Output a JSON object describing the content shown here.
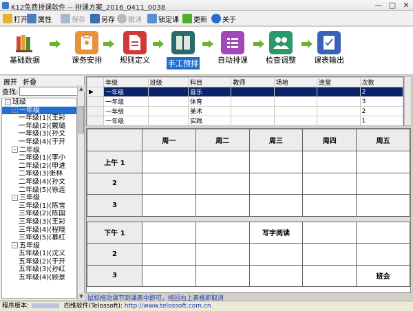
{
  "window": {
    "title": "K12免费排课软件 -- 排课方案_2016_0411_0038",
    "buttons": [
      "—",
      "□",
      "✕"
    ]
  },
  "toolbar": {
    "open": "打开",
    "properties": "属性",
    "save": "保存",
    "save_as": "另存",
    "undo": "撤消",
    "lock": "锁定课",
    "update": "更新",
    "about": "关于"
  },
  "flow": {
    "steps": [
      "基础数据",
      "课务安排",
      "规则定义",
      "手工预排",
      "自动排课",
      "检查调整",
      "课表输出"
    ],
    "active_index": 3
  },
  "left": {
    "expand": "展开",
    "collapse": "折叠",
    "search_label": "查找:",
    "tree": [
      {
        "text": "班级",
        "level": 0,
        "expander": "-"
      },
      {
        "text": "一年级",
        "level": 1,
        "expander": "-",
        "selected": true
      },
      {
        "text": "一年级(1)(王彩",
        "level": 2
      },
      {
        "text": "一年级(2)(戴璐",
        "level": 2
      },
      {
        "text": "一年级(3)(孙文",
        "level": 2
      },
      {
        "text": "一年级(4)(于开",
        "level": 2
      },
      {
        "text": "二年级",
        "level": 1,
        "expander": "-"
      },
      {
        "text": "二年级(1)(李小",
        "level": 2
      },
      {
        "text": "二年级(2)(申进",
        "level": 2
      },
      {
        "text": "二年级(3)张林",
        "level": 2
      },
      {
        "text": "二年级(4)(孙文",
        "level": 2
      },
      {
        "text": "二年级(5)(徐连",
        "level": 2
      },
      {
        "text": "三年级",
        "level": 1,
        "expander": "-"
      },
      {
        "text": "三年级(1)(陈雪",
        "level": 2
      },
      {
        "text": "三年级(2)(陈国",
        "level": 2
      },
      {
        "text": "三年级(3)(王彩",
        "level": 2
      },
      {
        "text": "三年级(4)(程晓",
        "level": 2
      },
      {
        "text": "三年级(5)(慕红",
        "level": 2
      },
      {
        "text": "五年级",
        "level": 1,
        "expander": "-"
      },
      {
        "text": "五年级(1)(沈义",
        "level": 2
      },
      {
        "text": "五年级(2)(于开",
        "level": 2
      },
      {
        "text": "五年级(3)(孙红",
        "level": 2
      },
      {
        "text": "五年级(4)(顾景",
        "level": 2
      }
    ]
  },
  "grid": {
    "headers": [
      "",
      "年级",
      "班级",
      "科目",
      "教师",
      "场地",
      "连堂",
      "次数"
    ],
    "rows": [
      {
        "marker": "▶",
        "cells": [
          "一年级",
          "",
          "音乐",
          "",
          "",
          "",
          "2"
        ],
        "current": true
      },
      {
        "marker": "",
        "cells": [
          "一年级",
          "",
          "体育",
          "",
          "",
          "",
          "3"
        ]
      },
      {
        "marker": "",
        "cells": [
          "一年级",
          "",
          "美术",
          "",
          "",
          "",
          "2"
        ]
      },
      {
        "marker": "",
        "cells": [
          "一年级",
          "",
          "实践",
          "",
          "",
          "",
          "1"
        ]
      }
    ]
  },
  "timetable": {
    "days": [
      "周一",
      "周二",
      "周三",
      "周四",
      "周五"
    ],
    "rows": [
      {
        "label": "上午 1",
        "cells": [
          "",
          "",
          "",
          "",
          ""
        ]
      },
      {
        "label": "2",
        "cells": [
          "",
          "",
          "",
          "",
          ""
        ]
      },
      {
        "label": "3",
        "cells": [
          "",
          "",
          "",
          "",
          ""
        ]
      },
      {
        "sep": true
      },
      {
        "label": "下午 1",
        "cells": [
          "",
          "",
          "写字阅读",
          "",
          ""
        ]
      },
      {
        "label": "2",
        "cells": [
          "",
          "",
          "",
          "",
          ""
        ]
      },
      {
        "label": "3",
        "cells": [
          "",
          "",
          "",
          "",
          "班会"
        ]
      }
    ]
  },
  "hint": "鼠标拖动课节到课表中即可，拖回右上表格即取消",
  "status": {
    "version_label": "程序版本:",
    "company": "四维软件(Telossoft):",
    "url": "http://www.telossoft.com.cn"
  },
  "colors": {
    "accent": "#1e6fd0",
    "flow_arrow": "#6ab32a",
    "grid_current": "#0a246a",
    "hint_text": "#1a3fb5"
  }
}
